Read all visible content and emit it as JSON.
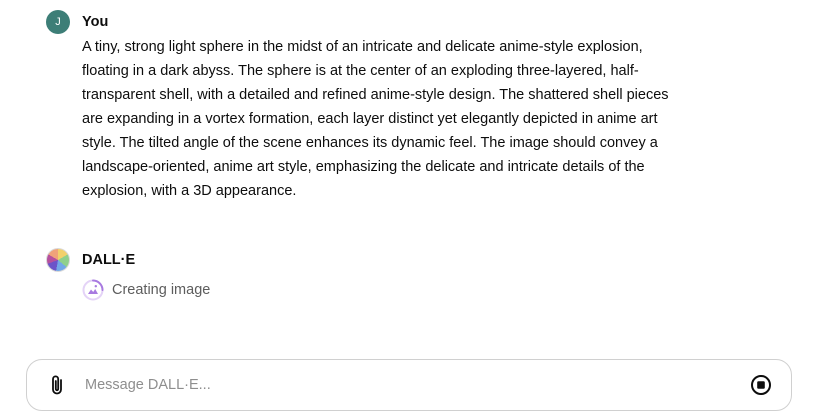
{
  "conversation": {
    "user_message": {
      "avatar_initial": "J",
      "author": "You",
      "text": "A tiny, strong light sphere in the midst of an intricate and delicate anime-style explosion, floating in a dark abyss. The sphere is at the center of an exploding three-layered, half-transparent shell, with a detailed and refined anime-style design. The shattered shell pieces are expanding in a vortex formation, each layer distinct yet elegantly depicted in anime art style. The tilted angle of the scene enhances its dynamic feel. The image should convey a landscape-oriented, anime art style, emphasizing the delicate and intricate details of the explosion, with a 3D appearance."
    },
    "assistant_message": {
      "author": "DALL·E",
      "status_icon": "image-generating-icon",
      "status_text": "Creating image"
    }
  },
  "composer": {
    "placeholder": "Message DALL·E...",
    "attach_icon": "paperclip-icon",
    "stop_icon": "stop-icon"
  },
  "colors": {
    "user_avatar": "#3d7e77",
    "status_icon_accent": "#a87ae0",
    "text_primary": "#0d0d0d",
    "text_muted": "#5d5d5d",
    "placeholder": "#8e8e8e",
    "border": "#d0d0d0"
  }
}
